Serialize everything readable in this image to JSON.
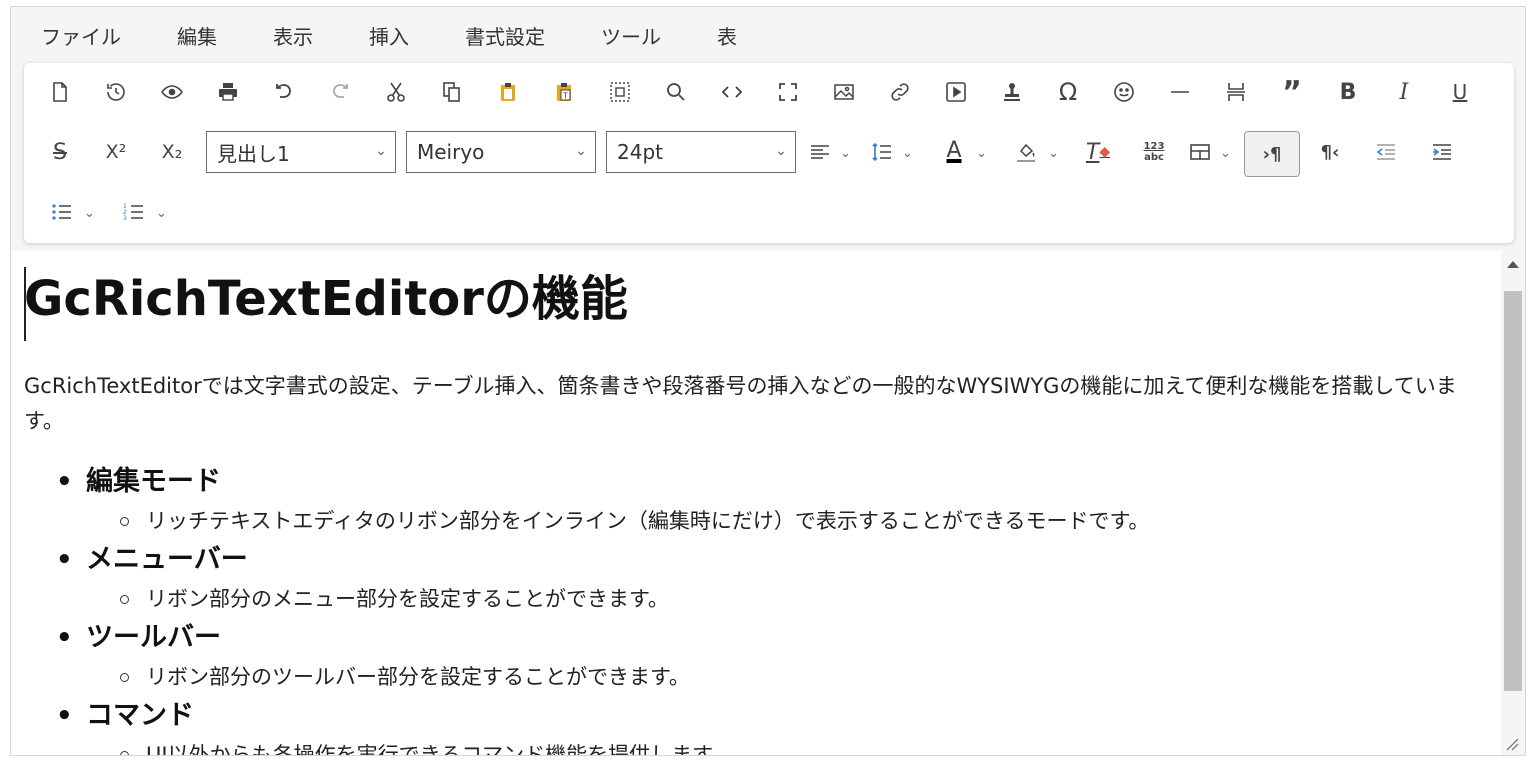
{
  "menu": [
    "ファイル",
    "編集",
    "表示",
    "挿入",
    "書式設定",
    "ツール",
    "表"
  ],
  "toolbar": {
    "heading_select": "見出し1",
    "font_select": "Meiryo",
    "size_select": "24pt",
    "strike_glyph": "S",
    "super_glyph": "X²",
    "sub_glyph": "X₂",
    "bold_glyph": "B",
    "italic_glyph": "I",
    "underline_glyph": "U",
    "omega_glyph": "Ω",
    "quote_glyph": "”",
    "ltr_glyph": "›¶",
    "rtl_glyph": "¶‹",
    "text_color_glyph": "A",
    "clear_format_glyph": "T",
    "wordcount_top": "123",
    "wordcount_bottom": "abc",
    "caret": "⌄",
    "colors": {
      "text_color": "#000000",
      "clear_format": "#e05a4f",
      "indent": "#2f7fd0",
      "paste": "#e6a81a"
    }
  },
  "content": {
    "title": "GcRichTextEditorの機能",
    "paragraph": "GcRichTextEditorでは文字書式の設定、テーブル挿入、箇条書きや段落番号の挿入などの一般的なWYSIWYGの機能に加えて便利な機能を搭載しています。",
    "items": [
      {
        "label": "編集モード",
        "sub": "リッチテキストエディタのリボン部分をインライン（編集時にだけ）で表示することができるモードです。"
      },
      {
        "label": "メニューバー",
        "sub": "リボン部分のメニュー部分を設定することができます。"
      },
      {
        "label": "ツールバー",
        "sub": "リボン部分のツールバー部分を設定することができます。"
      },
      {
        "label": "コマンド",
        "sub": "UI以外からも各操作を実行できるコマンド機能を提供します。"
      }
    ]
  }
}
